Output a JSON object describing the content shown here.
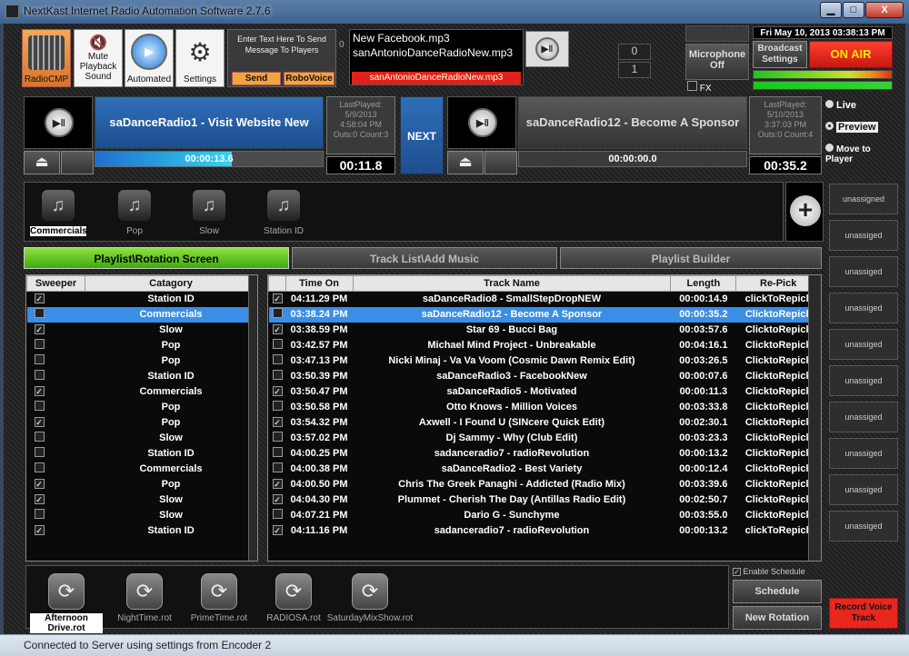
{
  "window": {
    "title": "NextKast Internet Radio Automation Software 2.7.6",
    "min": "▁",
    "max": "□",
    "close": "X"
  },
  "toolbar": {
    "radiocmp": "RadioCMP",
    "mute": "Mute\nPlayback\nSound",
    "automated": "Automated",
    "settings": "Settings",
    "enter_text": "Enter Text Here To Send Message To Players",
    "send": "Send",
    "robovoice": "RoboVoice",
    "zero_label": "0"
  },
  "nowplaying": {
    "line1": "New Facebook.mp3",
    "line2": "sanAntonioDanceRadioNew.mp3",
    "bar": "sanAntonioDanceRadioNew.mp3",
    "counter_top": "0",
    "counter_bottom": "1"
  },
  "mic": {
    "label": "Microphone Off",
    "fx": "FX"
  },
  "datetime": "Fri May 10, 2013  03:38:13 PM",
  "broadcast_settings": "Broadcast Settings",
  "on_air": "ON AIR",
  "deck_a": {
    "title": "saDanceRadio1 - Visit Website New",
    "last_played": "LastPlayed:\n5/9/2013\n4:58:04 PM\nOuts:0 Count:3",
    "progress_time": "00:00:13.6",
    "progress": 0.6,
    "remaining": "00:11.8"
  },
  "next_label": "NEXT",
  "deck_b": {
    "title": "saDanceRadio12 - Become A Sponsor",
    "last_played": "LastPlayed:\n5/10/2013\n3:37:03 PM\nOuts:0 Count:4",
    "progress_time": "00:00:00.0",
    "remaining": "00:35.2"
  },
  "modes": [
    {
      "label": "Live"
    },
    {
      "label": "Preview",
      "selected": true
    },
    {
      "label": "Move to Player"
    }
  ],
  "categories": [
    "Commercials",
    "Pop",
    "Slow",
    "Station ID"
  ],
  "tabs": [
    "Playlist\\Rotation Screen",
    "Track List\\Add Music",
    "Playlist Builder"
  ],
  "category_table": {
    "headers": [
      "Sweeper",
      "Catagory"
    ],
    "rows": [
      {
        "checked": true,
        "name": "Station ID"
      },
      {
        "checked": false,
        "name": "Commercials",
        "selected": true
      },
      {
        "checked": true,
        "name": "Slow"
      },
      {
        "checked": false,
        "name": "Pop"
      },
      {
        "checked": false,
        "name": "Pop"
      },
      {
        "checked": false,
        "name": "Station ID"
      },
      {
        "checked": true,
        "name": "Commercials"
      },
      {
        "checked": false,
        "name": "Pop"
      },
      {
        "checked": true,
        "name": "Pop"
      },
      {
        "checked": false,
        "name": "Slow"
      },
      {
        "checked": false,
        "name": "Station ID"
      },
      {
        "checked": false,
        "name": "Commercials"
      },
      {
        "checked": true,
        "name": "Pop"
      },
      {
        "checked": true,
        "name": "Slow"
      },
      {
        "checked": false,
        "name": "Slow"
      },
      {
        "checked": true,
        "name": "Station ID"
      }
    ]
  },
  "track_table": {
    "headers": [
      "Time On",
      "Track Name",
      "Length",
      "Re-Pick"
    ],
    "rows": [
      {
        "checked": true,
        "time": "04:11.29 PM",
        "name": "saDanceRadio8 - SmallStepDropNEW",
        "length": "00:00:14.9",
        "repick": "clickToRepick"
      },
      {
        "checked": false,
        "time": "03:38.24 PM",
        "name": "saDanceRadio12 - Become A Sponsor",
        "length": "00:00:35.2",
        "repick": "ClicktoRepick",
        "selected": true
      },
      {
        "checked": true,
        "time": "03:38.59 PM",
        "name": "Star 69 - Bucci Bag",
        "length": "00:03:57.6",
        "repick": "ClicktoRepick"
      },
      {
        "checked": false,
        "time": "03:42.57 PM",
        "name": "Michael Mind Project - Unbreakable",
        "length": "00:04:16.1",
        "repick": "ClicktoRepick"
      },
      {
        "checked": false,
        "time": "03:47.13 PM",
        "name": "Nicki Minaj - Va Va Voom (Cosmic Dawn Remix Edit)",
        "length": "00:03:26.5",
        "repick": "ClicktoRepick"
      },
      {
        "checked": false,
        "time": "03:50.39 PM",
        "name": "saDanceRadio3 - FacebookNew",
        "length": "00:00:07.6",
        "repick": "ClicktoRepick"
      },
      {
        "checked": true,
        "time": "03:50.47 PM",
        "name": "saDanceRadio5 - Motivated",
        "length": "00:00:11.3",
        "repick": "ClicktoRepick"
      },
      {
        "checked": false,
        "time": "03:50.58 PM",
        "name": "Otto Knows - Million Voices",
        "length": "00:03:33.8",
        "repick": "ClicktoRepick"
      },
      {
        "checked": true,
        "time": "03:54.32 PM",
        "name": "Axwell - I Found U (SINcere Quick Edit)",
        "length": "00:02:30.1",
        "repick": "ClicktoRepick"
      },
      {
        "checked": false,
        "time": "03:57.02 PM",
        "name": "Dj Sammy - Why (Club Edit)",
        "length": "00:03:23.3",
        "repick": "ClicktoRepick"
      },
      {
        "checked": false,
        "time": "04:00.25 PM",
        "name": "sadanceradio7 - radioRevolution",
        "length": "00:00:13.2",
        "repick": "ClicktoRepick"
      },
      {
        "checked": false,
        "time": "04:00.38 PM",
        "name": "saDanceRadio2 - Best Variety",
        "length": "00:00:12.4",
        "repick": "ClicktoRepick"
      },
      {
        "checked": true,
        "time": "04:00.50 PM",
        "name": "Chris The Greek Panaghi - Addicted (Radio Mix)",
        "length": "00:03:39.6",
        "repick": "ClicktoRepick"
      },
      {
        "checked": true,
        "time": "04:04.30 PM",
        "name": "Plummet - Cherish The Day (Antillas Radio Edit)",
        "length": "00:02:50.7",
        "repick": "ClicktoRepick"
      },
      {
        "checked": false,
        "time": "04:07.21 PM",
        "name": "Dario G - Sunchyme",
        "length": "00:03:55.0",
        "repick": "ClicktoRepick"
      },
      {
        "checked": true,
        "time": "04:11.16 PM",
        "name": "sadanceradio7 - radioRevolution",
        "length": "00:00:13.2",
        "repick": "clickToRepick"
      }
    ]
  },
  "side_buttons": [
    "unassigned",
    "unassiged",
    "unassiged",
    "unassiged",
    "unassiged",
    "unassiged",
    "unassiged",
    "unassiged",
    "unassiged",
    "unassiged"
  ],
  "rotations": [
    "Afternoon Drive.rot",
    "NightTime.rot",
    "PrimeTime.rot",
    "RADIOSA.rot",
    "SaturdayMixShow.rot"
  ],
  "enable_schedule": "Enable Schedule",
  "schedule": "Schedule",
  "new_rotation": "New Rotation",
  "record_voice": "Record Voice Track",
  "status": "Connected to Server using settings from Encoder 2",
  "colors": {
    "on_air": "#e8271d",
    "accent_green": "#55c21c",
    "selection_blue": "#3a8ee6",
    "deck_blue": "#2a63a8"
  },
  "icons": {
    "play": "play-pause-icon",
    "eject": "eject-icon",
    "music": "music-note-icon",
    "refresh": "rotation-icon",
    "plus": "plus-icon",
    "gear": "gear-icon",
    "mute": "mute-icon",
    "levels": "levels-icon"
  }
}
